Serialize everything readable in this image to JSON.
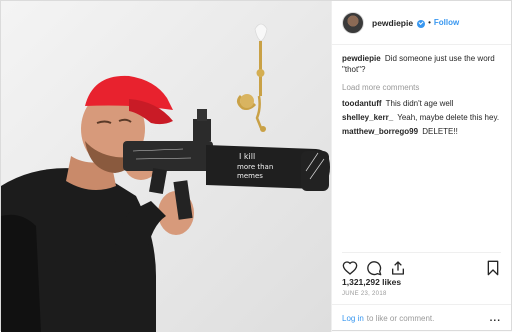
{
  "post": {
    "username": "pewdiepie",
    "follow_label": "Follow",
    "separator": "•",
    "caption_user": "pewdiepie",
    "caption_text": "Did someone just use the word \"thot\"?",
    "load_more": "Load more comments",
    "comments": [
      {
        "user": "toodantuff",
        "text": "This didn't age well"
      },
      {
        "user": "shelley_kerr_",
        "text": "Yeah, maybe delete this hey."
      },
      {
        "user": "matthew_borrego99",
        "text": "DELETE!!"
      }
    ],
    "likes": "1,321,292 likes",
    "date": "JUNE 23, 2018",
    "login_link": "Log in",
    "login_text": "to like or comment.",
    "more_label": "..."
  },
  "photo": {
    "gun_text_1": "I kill",
    "gun_text_2": "more than",
    "gun_text_3": "memes"
  },
  "colors": {
    "accent": "#3897f0",
    "cap": "#e8222e",
    "wall": "#ececec"
  }
}
